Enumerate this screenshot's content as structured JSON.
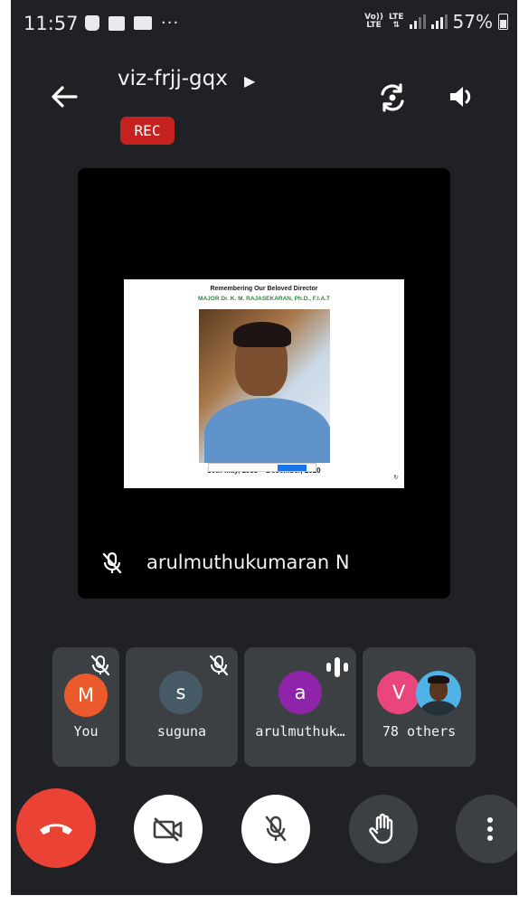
{
  "status_bar": {
    "time": "11:57",
    "dots": "···",
    "volte_line1": "Vo))",
    "volte_line2": "LTE",
    "lte_line1": "LTE",
    "lte_line2": "⇅",
    "battery_percent": "57%"
  },
  "header": {
    "meeting_code": "viz-frjj-gqx",
    "arrow": "▶",
    "rec_label": "REC"
  },
  "main_tile": {
    "slide_title": "Remembering Our Beloved Director",
    "slide_subtitle": "MAJOR Dr. K. M. RAJASEKARAN, Ph.D., F.I.A.T",
    "slide_dates": "30th May, 1958 – December, 2020",
    "slide_corner": "↻",
    "speaker_name": "arulmuthukumaran N"
  },
  "participants": [
    {
      "initial": "M",
      "label": "You",
      "color": "#ea5a2b"
    },
    {
      "initial": "s",
      "label": "suguna",
      "color": "#455a64"
    },
    {
      "initial": "a",
      "label": "arulmuthuk…",
      "color": "#8e24aa"
    },
    {
      "initial": "V",
      "label": "78 others",
      "color": "#e8467c"
    }
  ],
  "controls": {
    "end_call": "end-call",
    "camera": "camera-off",
    "mic": "mic-off",
    "hand": "raise-hand",
    "more": "more-options"
  },
  "colors": {
    "background": "#202124",
    "tile": "#3c4043",
    "end_call": "#ea4335",
    "rec": "#c5221f"
  }
}
